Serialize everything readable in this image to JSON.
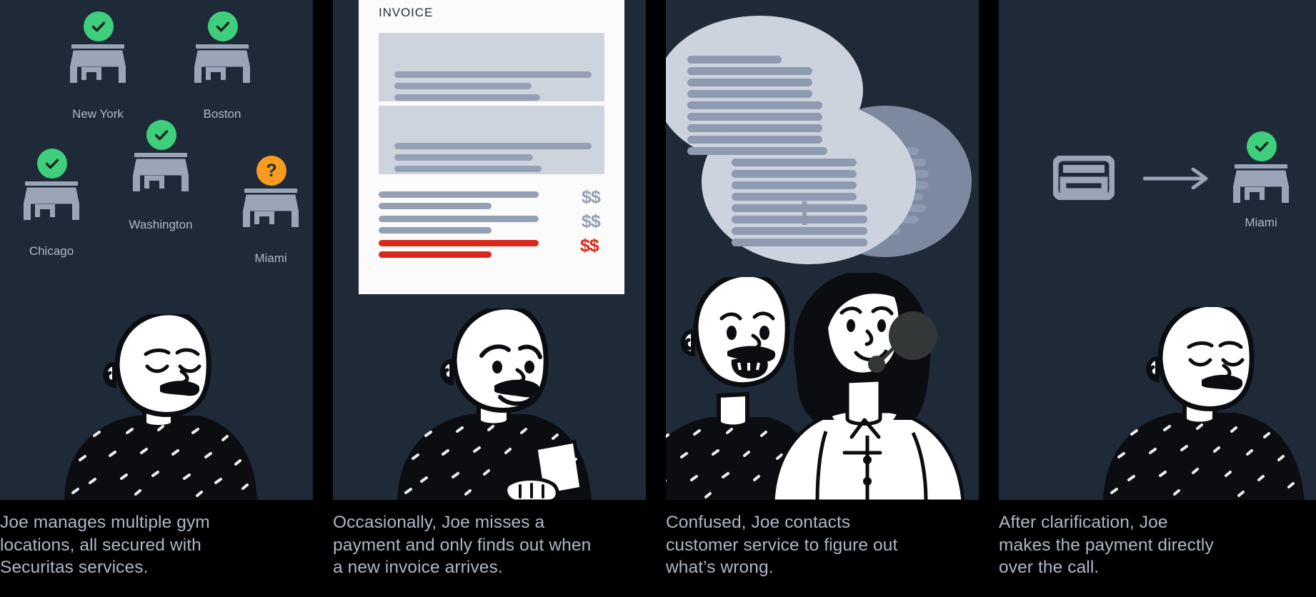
{
  "meta": {
    "kind": "four-panel-storyboard-illustration",
    "background_color": "#000000",
    "panel_color": "#1f2a39",
    "text_color": "#aeb8c6",
    "accent_green": "#3ece7c",
    "accent_orange": "#f99b1c",
    "accent_red": "#d9291c",
    "icon_gray": "#9aa6b8"
  },
  "panels": [
    {
      "id": "panel-1",
      "caption": "Joe manages multiple gym\nlocations, all secured with\nSecuritas services.",
      "stores": [
        {
          "label": "New York",
          "status": "check",
          "status_color": "#3ece7c"
        },
        {
          "label": "Boston",
          "status": "check",
          "status_color": "#3ece7c"
        },
        {
          "label": "Chicago",
          "status": "check",
          "status_color": "#3ece7c"
        },
        {
          "label": "Washington",
          "status": "check",
          "status_color": "#3ece7c"
        },
        {
          "label": "Miami",
          "status": "question",
          "status_color": "#f99b1c",
          "status_glyph": "?"
        }
      ],
      "character": {
        "name": "joe",
        "expression": "calm-eyes-closed"
      }
    },
    {
      "id": "panel-2",
      "caption": "Occasionally, Joe misses a\npayment and only finds out when\na new invoice arrives.",
      "document": {
        "title": "INVOICE",
        "amount_rows": [
          {
            "amount": "$$",
            "color": "#94a0b4",
            "overdue": false
          },
          {
            "amount": "$$",
            "color": "#94a0b4",
            "overdue": false
          },
          {
            "amount": "$$",
            "color": "#d9291c",
            "overdue": true
          }
        ]
      },
      "character": {
        "name": "joe",
        "expression": "worried-holding-document"
      }
    },
    {
      "id": "panel-3",
      "caption": "Confused, Joe contacts\ncustomer service to figure out\nwhat’s wrong.",
      "bubbles": [
        {
          "id": "bubble-back",
          "lines": 8,
          "style": "muted"
        },
        {
          "id": "bubble-front-top",
          "lines": 9,
          "style": "light"
        },
        {
          "id": "bubble-front-bottom",
          "lines": 9,
          "style": "light",
          "glyph": "!"
        }
      ],
      "characters": [
        {
          "name": "joe",
          "expression": "surprised-mouth-open"
        },
        {
          "name": "customer-service-agent",
          "expression": "smiling",
          "accessory": "headset"
        }
      ]
    },
    {
      "id": "panel-4",
      "caption": "After clarification, Joe\nmakes the payment directly\nover the call.",
      "payment_flow": {
        "source_icon": "credit-card-icon",
        "arrow_icon": "arrow-right-icon",
        "target_store": {
          "label": "Miami",
          "status": "check",
          "status_color": "#3ece7c"
        }
      },
      "character": {
        "name": "joe",
        "expression": "relieved-eyes-closed"
      }
    }
  ]
}
